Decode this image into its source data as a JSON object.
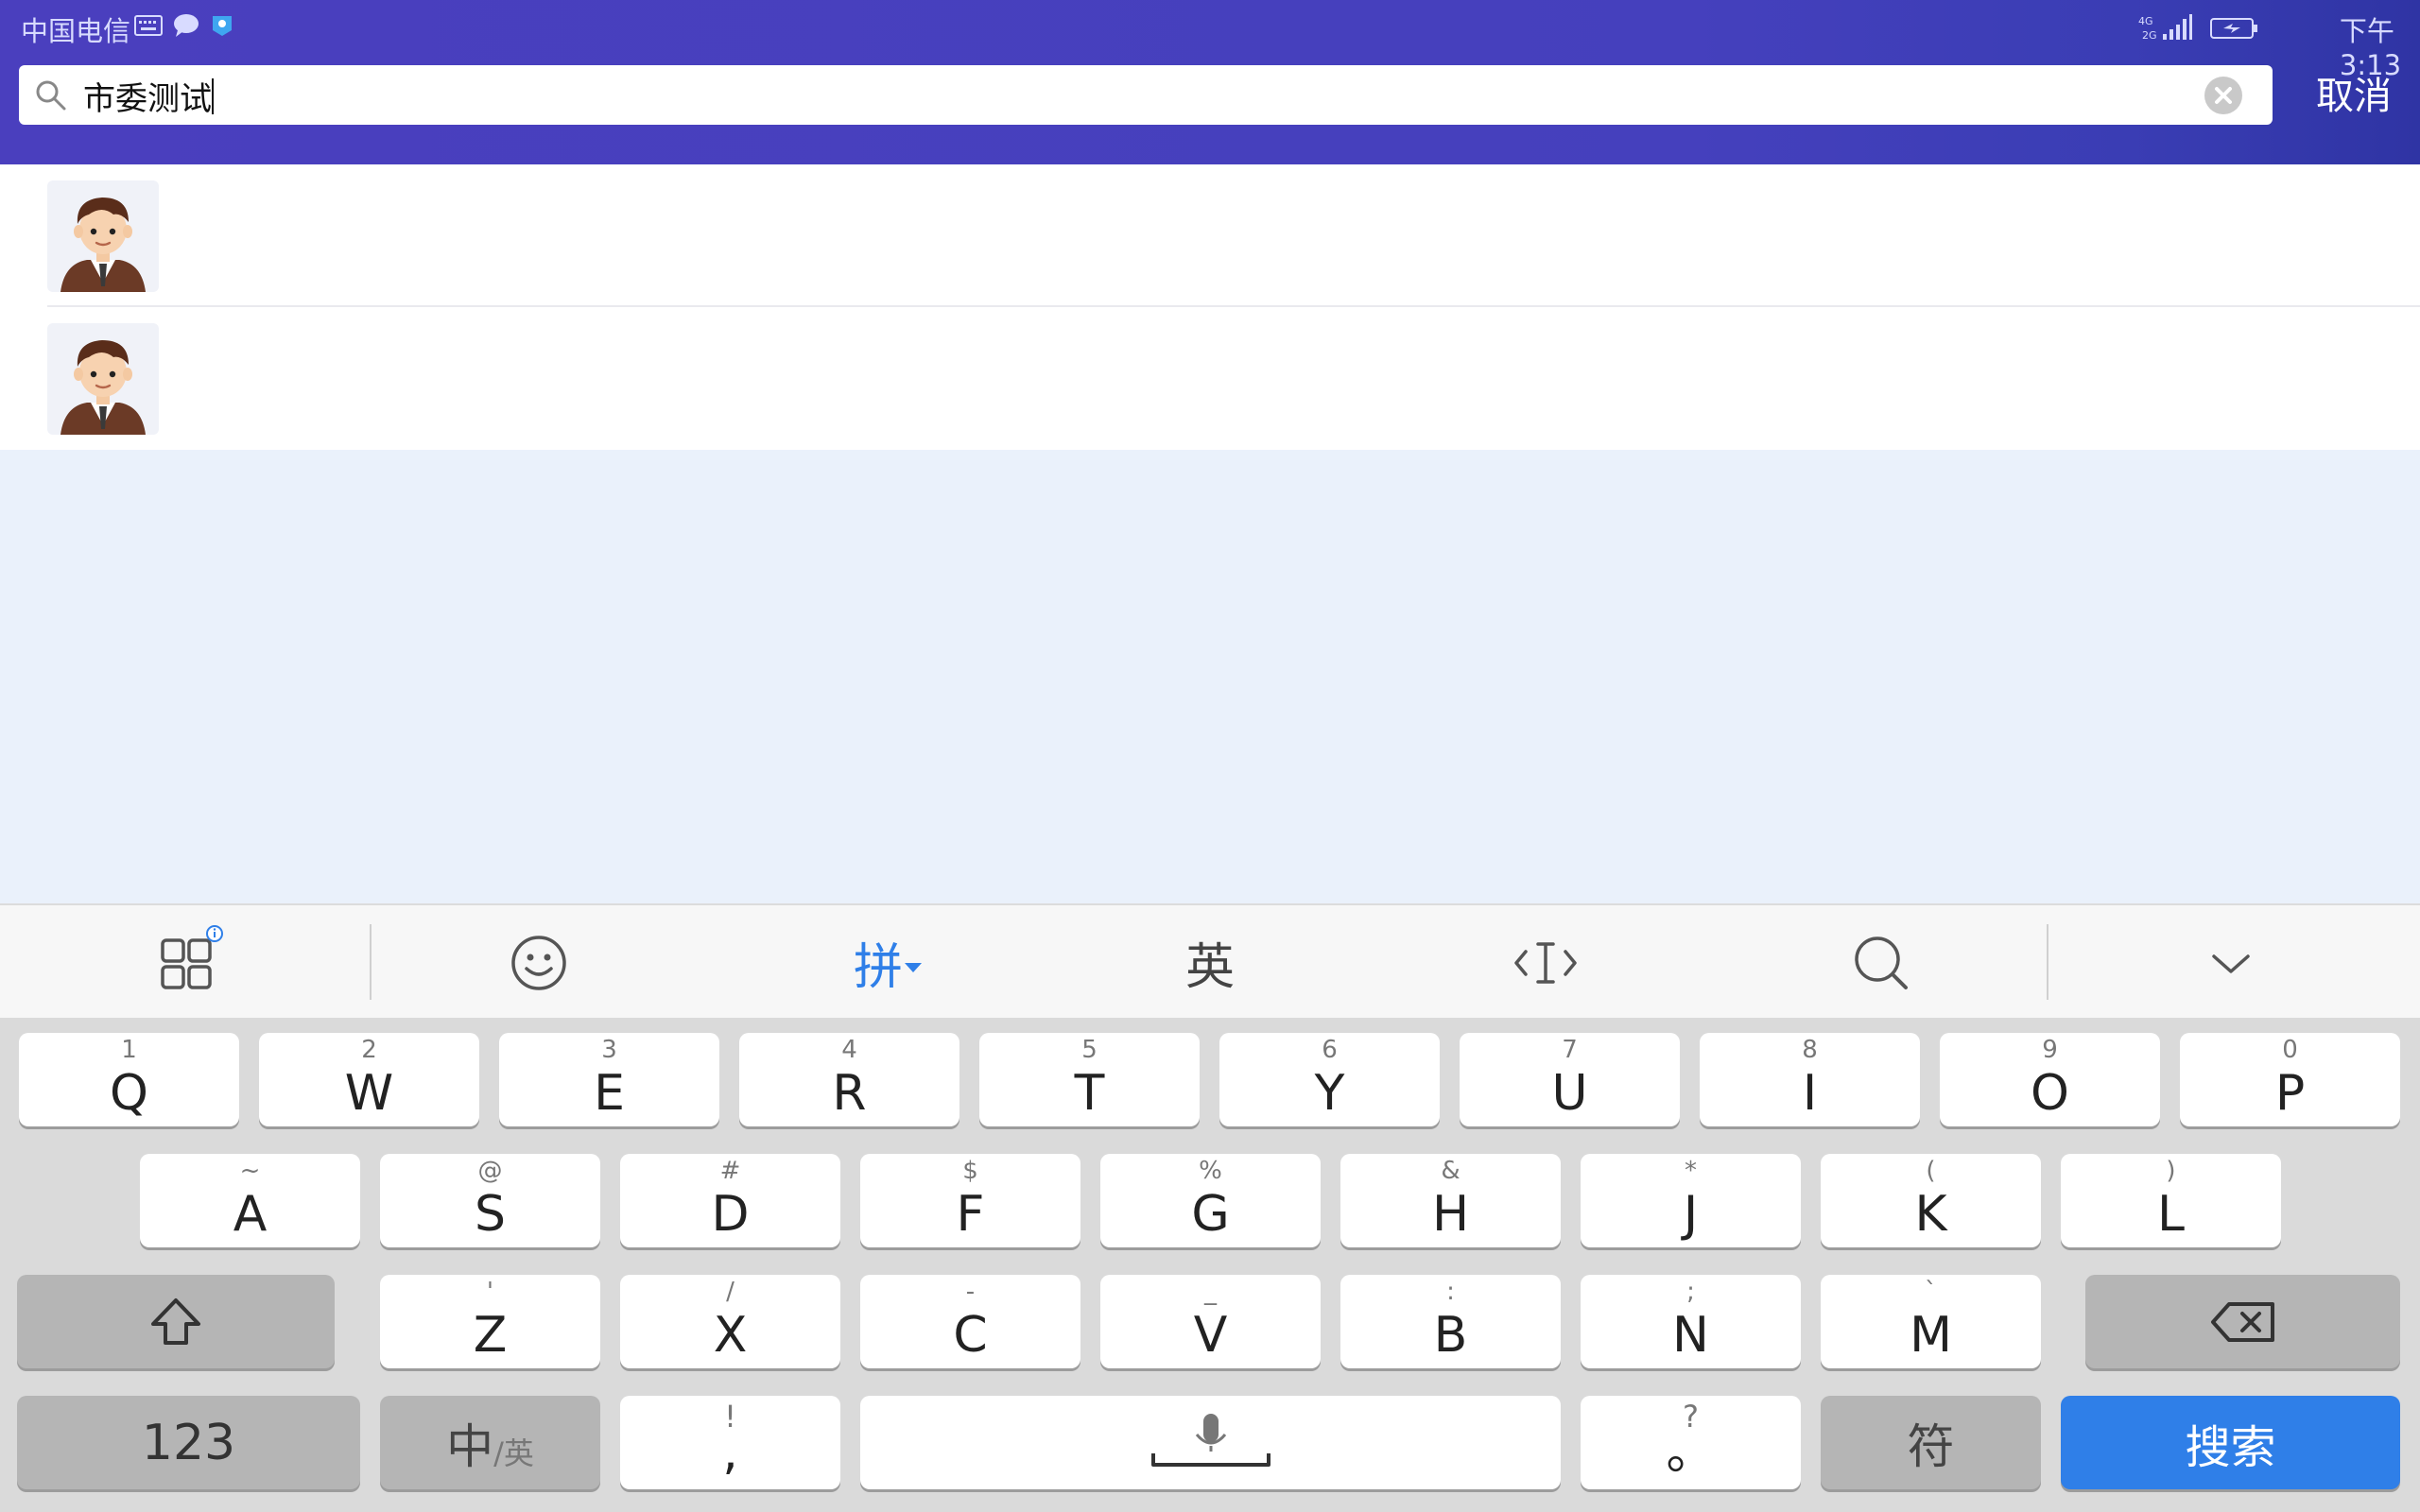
{
  "status_bar": {
    "carrier": "中国电信",
    "network": "4G 2G",
    "time": "下午3:13"
  },
  "search": {
    "query": "市委测试",
    "cancel_label": "取消"
  },
  "results": [
    {
      "avatar": "businessman-avatar"
    },
    {
      "avatar": "businessman-avatar"
    }
  ],
  "keyboard_toolbar": {
    "pinyin_label": "拼",
    "english_label": "英",
    "icons": [
      "apps-grid-icon",
      "emoji-icon",
      "cursor-icon",
      "search-icon",
      "collapse-keyboard-icon"
    ]
  },
  "keyboard": {
    "row1": [
      {
        "sub": "1",
        "main": "Q"
      },
      {
        "sub": "2",
        "main": "W"
      },
      {
        "sub": "3",
        "main": "E"
      },
      {
        "sub": "4",
        "main": "R"
      },
      {
        "sub": "5",
        "main": "T"
      },
      {
        "sub": "6",
        "main": "Y"
      },
      {
        "sub": "7",
        "main": "U"
      },
      {
        "sub": "8",
        "main": "I"
      },
      {
        "sub": "9",
        "main": "O"
      },
      {
        "sub": "0",
        "main": "P"
      }
    ],
    "row2": [
      {
        "sub": "~",
        "main": "A"
      },
      {
        "sub": "@",
        "main": "S"
      },
      {
        "sub": "#",
        "main": "D"
      },
      {
        "sub": "$",
        "main": "F"
      },
      {
        "sub": "%",
        "main": "G"
      },
      {
        "sub": "&",
        "main": "H"
      },
      {
        "sub": "*",
        "main": "J"
      },
      {
        "sub": "(",
        "main": "K"
      },
      {
        "sub": ")",
        "main": "L"
      }
    ],
    "row3": [
      {
        "sub": "'",
        "main": "Z"
      },
      {
        "sub": "/",
        "main": "X"
      },
      {
        "sub": "-",
        "main": "C"
      },
      {
        "sub": "_",
        "main": "V"
      },
      {
        "sub": ":",
        "main": "B"
      },
      {
        "sub": ";",
        "main": "N"
      },
      {
        "sub": "`",
        "main": "M"
      }
    ],
    "numbers_label": "123",
    "lang_label_main": "中",
    "lang_label_sub": "/英",
    "comma_sub": "!",
    "comma_main": ",",
    "period_sub": "?",
    "period_main": "。",
    "symbols_label": "符",
    "search_key_label": "搜索",
    "accent_color": "#2f7fe8"
  }
}
